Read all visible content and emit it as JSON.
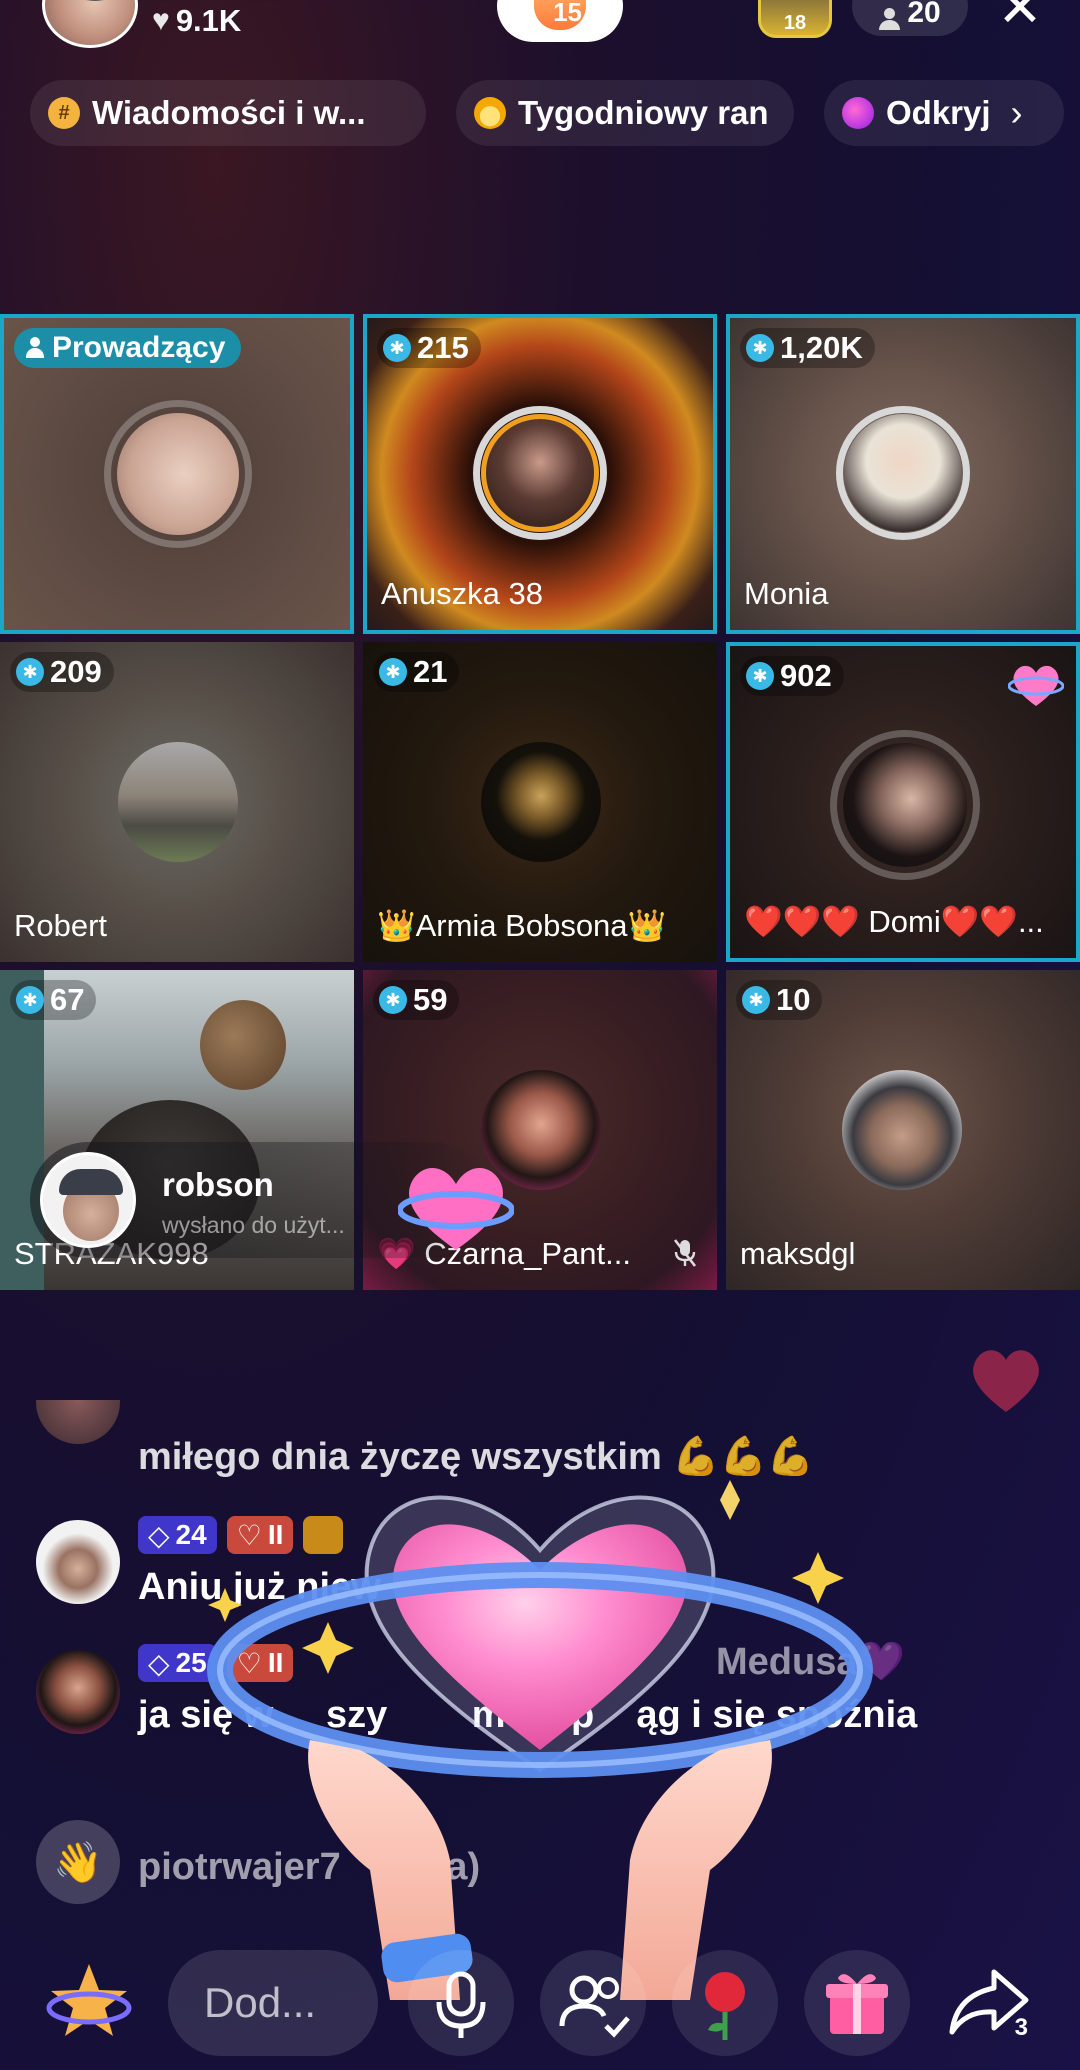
{
  "header": {
    "likes": "9.1K",
    "pill_badge": "15",
    "ranker_badge": "18",
    "viewer_count": "20"
  },
  "categories": [
    {
      "label": "Wiadomości i w...",
      "icon": "hashtag-icon"
    },
    {
      "label": "Tygodniowy ran",
      "icon": "fire-icon"
    },
    {
      "label": "Odkryj",
      "icon": "planet-icon"
    }
  ],
  "grid": {
    "host_label": "Prowadzący",
    "tiles": [
      {
        "score": "",
        "name": ""
      },
      {
        "score": "215",
        "name": "Anuszka 38"
      },
      {
        "score": "1,20K",
        "name": "Monia"
      },
      {
        "score": "209",
        "name": "Robert"
      },
      {
        "score": "21",
        "name": "👑Armia Bobsona👑"
      },
      {
        "score": "902",
        "name": "❤️❤️❤️ Domi❤️❤️..."
      },
      {
        "score": "67",
        "name": "STRAZAK998"
      },
      {
        "score": "59",
        "name": "💗 Czarna_Pant..."
      },
      {
        "score": "10",
        "name": "maksdgl"
      }
    ]
  },
  "gift_popup": {
    "user": "robson",
    "text": "wysłano do użyt..."
  },
  "chat": [
    {
      "text": "miłego dnia życzę wszystkim 💪💪💪"
    },
    {
      "badge_gem": "24",
      "badge_heart": "II",
      "text": "Aniu już niew"
    },
    {
      "badge_gem": "25",
      "badge_heart": "II",
      "name_fragment": "Medusa💜",
      "text": "ja się w     szy        m na p    ąg i się spóźnia"
    },
    {
      "text": "piotrwajer7    zył(a)"
    }
  ],
  "bottom_bar": {
    "comment_placeholder": "Dod...",
    "share_count": "3"
  },
  "colors": {
    "accent_border": "#1aa7c8",
    "host_tag": "#1d8ea8",
    "gem_badge": "#4036c9",
    "heart_badge": "#c94a3c"
  }
}
